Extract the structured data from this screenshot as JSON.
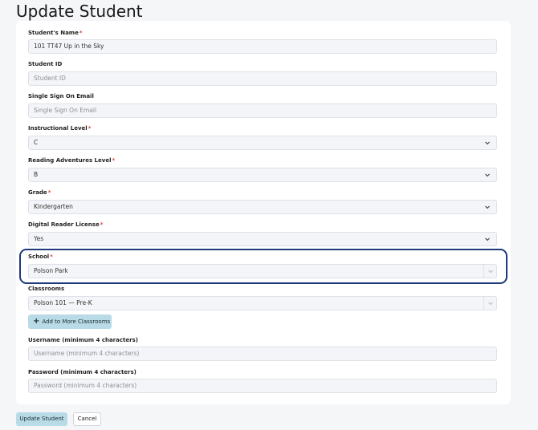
{
  "page": {
    "title": "Update Student"
  },
  "fields": {
    "student_name": {
      "label": "Student's Name",
      "required": "*",
      "value": "101 TT47 Up in the Sky"
    },
    "student_id": {
      "label": "Student ID",
      "placeholder": "Student ID"
    },
    "sso_email": {
      "label": "Single Sign On Email",
      "placeholder": "Single Sign On Email"
    },
    "instructional_level": {
      "label": "Instructional Level",
      "required": "*",
      "value": "C"
    },
    "reading_adventures_level": {
      "label": "Reading Adventures Level",
      "required": "*",
      "value": "B"
    },
    "grade": {
      "label": "Grade",
      "required": "*",
      "value": "Kindergarten"
    },
    "digital_reader_license": {
      "label": "Digital Reader License",
      "required": "*",
      "value": "Yes"
    },
    "school": {
      "label": "School",
      "required": "*",
      "value": "Polson Park"
    },
    "classrooms": {
      "label": "Classrooms",
      "value": "Polson 101 — Pre-K"
    },
    "username": {
      "label": "Username (minimum 4 characters)",
      "placeholder": "Username (minimum 4 characters)"
    },
    "password": {
      "label": "Password (minimum 4 characters)",
      "placeholder": "Password (minimum 4 characters)"
    }
  },
  "buttons": {
    "add_classrooms": "Add to More Classrooms",
    "update_student": "Update Student",
    "cancel": "Cancel"
  },
  "icons": {
    "select_arrow": "chevron-down-icon",
    "add": "plus-icon"
  },
  "colors": {
    "highlight_border": "#1e3a7b",
    "primary_button": "#b8dbe7",
    "required_asterisk": "#d6453d"
  }
}
